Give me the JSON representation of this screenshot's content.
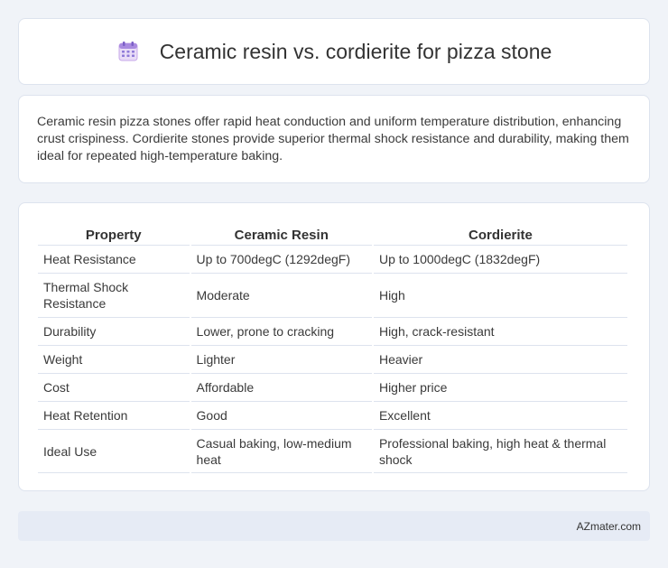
{
  "header": {
    "title": "Ceramic resin vs. cordierite for pizza stone",
    "icon": "calendar-icon"
  },
  "intro": {
    "text": "Ceramic resin pizza stones offer rapid heat conduction and uniform temperature distribution, enhancing crust crispiness. Cordierite stones provide superior thermal shock resistance and durability, making them ideal for repeated high-temperature baking."
  },
  "table": {
    "headers": [
      "Property",
      "Ceramic Resin",
      "Cordierite"
    ],
    "rows": [
      [
        "Heat Resistance",
        "Up to 700degC (1292degF)",
        "Up to 1000degC (1832degF)"
      ],
      [
        "Thermal Shock Resistance",
        "Moderate",
        "High"
      ],
      [
        "Durability",
        "Lower, prone to cracking",
        "High, crack-resistant"
      ],
      [
        "Weight",
        "Lighter",
        "Heavier"
      ],
      [
        "Cost",
        "Affordable",
        "Higher price"
      ],
      [
        "Heat Retention",
        "Good",
        "Excellent"
      ],
      [
        "Ideal Use",
        "Casual baking, low-medium heat",
        "Professional baking, high heat & thermal shock"
      ]
    ]
  },
  "footer": {
    "brand": "AZmater.com"
  }
}
